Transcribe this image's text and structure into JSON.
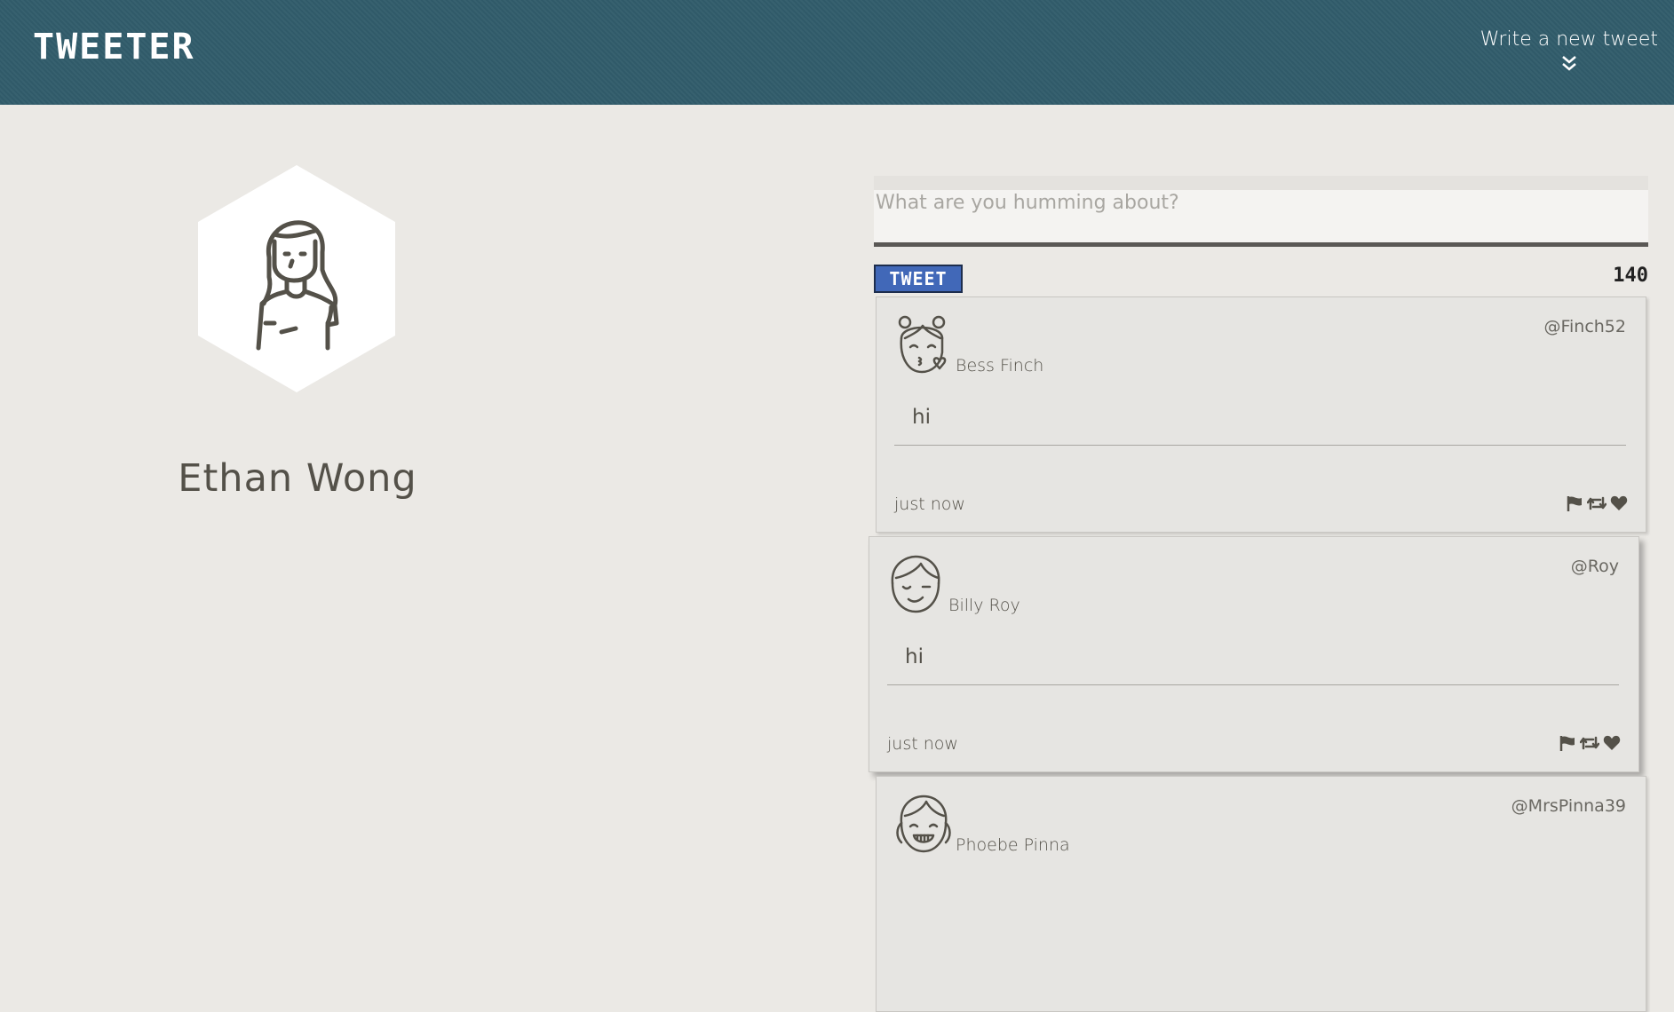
{
  "header": {
    "logo": "TWEETER",
    "compose_label": "Write a new tweet"
  },
  "profile": {
    "name": "Ethan  Wong",
    "avatar_icon": "girl-avatar-icon"
  },
  "composer": {
    "placeholder": "What are you humming about?",
    "button_label": "TWEET",
    "counter": "140"
  },
  "tweets": [
    {
      "name": "Bess Finch",
      "handle": "@Finch52",
      "content": "hi",
      "time": "just now",
      "avatar_icon": "girl-kiss-avatar-icon"
    },
    {
      "name": "Billy Roy",
      "handle": "@Roy",
      "content": "hi",
      "time": "just now",
      "avatar_icon": "boy-wink-avatar-icon"
    },
    {
      "name": "Phoebe Pinna",
      "handle": "@MrsPinna39",
      "content": "",
      "time": "",
      "avatar_icon": "girl-braces-avatar-icon"
    }
  ],
  "colors": {
    "navbar": "#325d6c",
    "background": "#ebe9e5",
    "tweet_button": "#4168b8",
    "text": "#545149"
  }
}
